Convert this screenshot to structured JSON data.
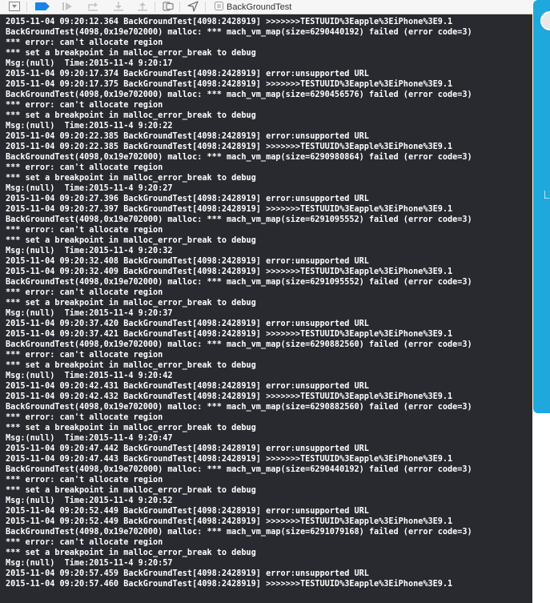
{
  "toolbar": {
    "icons": [
      "hide-console-icon",
      "breakpoint-icon",
      "continue-icon",
      "step-over-icon",
      "step-in-icon",
      "step-out-icon",
      "view-debugger-icon",
      "simulate-location-icon",
      "target-app-icon"
    ],
    "target": "BackGroundTest"
  },
  "colors": {
    "console_bg": "#292a30",
    "console_text": "#ffffff",
    "accent": "#1fa8dc",
    "breakpoint": "#1a83e6"
  },
  "console": {
    "lines": [
      "2015-11-04 09:20:12.364 BackGroundTest[4098:2428919] >>>>>>>TESTUUID%3Eapple%3EiPhone%3E9.1",
      "BackGroundTest(4098,0x19e702000) malloc: *** mach_vm_map(size=6290440192) failed (error code=3)",
      "*** error: can't allocate region",
      "*** set a breakpoint in malloc_error_break to debug",
      "Msg:(null)  Time:2015-11-4 9:20:17",
      "2015-11-04 09:20:17.374 BackGroundTest[4098:2428919] error:unsupported URL",
      "2015-11-04 09:20:17.375 BackGroundTest[4098:2428919] >>>>>>>TESTUUID%3Eapple%3EiPhone%3E9.1",
      "BackGroundTest(4098,0x19e702000) malloc: *** mach_vm_map(size=6290456576) failed (error code=3)",
      "*** error: can't allocate region",
      "*** set a breakpoint in malloc_error_break to debug",
      "Msg:(null)  Time:2015-11-4 9:20:22",
      "2015-11-04 09:20:22.385 BackGroundTest[4098:2428919] error:unsupported URL",
      "2015-11-04 09:20:22.385 BackGroundTest[4098:2428919] >>>>>>>TESTUUID%3Eapple%3EiPhone%3E9.1",
      "BackGroundTest(4098,0x19e702000) malloc: *** mach_vm_map(size=6290980864) failed (error code=3)",
      "*** error: can't allocate region",
      "*** set a breakpoint in malloc_error_break to debug",
      "Msg:(null)  Time:2015-11-4 9:20:27",
      "2015-11-04 09:20:27.396 BackGroundTest[4098:2428919] error:unsupported URL",
      "2015-11-04 09:20:27.397 BackGroundTest[4098:2428919] >>>>>>>TESTUUID%3Eapple%3EiPhone%3E9.1",
      "BackGroundTest(4098,0x19e702000) malloc: *** mach_vm_map(size=6291095552) failed (error code=3)",
      "*** error: can't allocate region",
      "*** set a breakpoint in malloc_error_break to debug",
      "Msg:(null)  Time:2015-11-4 9:20:32",
      "2015-11-04 09:20:32.408 BackGroundTest[4098:2428919] error:unsupported URL",
      "2015-11-04 09:20:32.409 BackGroundTest[4098:2428919] >>>>>>>TESTUUID%3Eapple%3EiPhone%3E9.1",
      "BackGroundTest(4098,0x19e702000) malloc: *** mach_vm_map(size=6291095552) failed (error code=3)",
      "*** error: can't allocate region",
      "*** set a breakpoint in malloc_error_break to debug",
      "Msg:(null)  Time:2015-11-4 9:20:37",
      "2015-11-04 09:20:37.420 BackGroundTest[4098:2428919] error:unsupported URL",
      "2015-11-04 09:20:37.421 BackGroundTest[4098:2428919] >>>>>>>TESTUUID%3Eapple%3EiPhone%3E9.1",
      "BackGroundTest(4098,0x19e702000) malloc: *** mach_vm_map(size=6290882560) failed (error code=3)",
      "*** error: can't allocate region",
      "*** set a breakpoint in malloc_error_break to debug",
      "Msg:(null)  Time:2015-11-4 9:20:42",
      "2015-11-04 09:20:42.431 BackGroundTest[4098:2428919] error:unsupported URL",
      "2015-11-04 09:20:42.432 BackGroundTest[4098:2428919] >>>>>>>TESTUUID%3Eapple%3EiPhone%3E9.1",
      "BackGroundTest(4098,0x19e702000) malloc: *** mach_vm_map(size=6290882560) failed (error code=3)",
      "*** error: can't allocate region",
      "*** set a breakpoint in malloc_error_break to debug",
      "Msg:(null)  Time:2015-11-4 9:20:47",
      "2015-11-04 09:20:47.442 BackGroundTest[4098:2428919] error:unsupported URL",
      "2015-11-04 09:20:47.443 BackGroundTest[4098:2428919] >>>>>>>TESTUUID%3Eapple%3EiPhone%3E9.1",
      "BackGroundTest(4098,0x19e702000) malloc: *** mach_vm_map(size=6290440192) failed (error code=3)",
      "*** error: can't allocate region",
      "*** set a breakpoint in malloc_error_break to debug",
      "Msg:(null)  Time:2015-11-4 9:20:52",
      "2015-11-04 09:20:52.449 BackGroundTest[4098:2428919] error:unsupported URL",
      "2015-11-04 09:20:52.449 BackGroundTest[4098:2428919] >>>>>>>TESTUUID%3Eapple%3EiPhone%3E9.1",
      "BackGroundTest(4098,0x19e702000) malloc: *** mach_vm_map(size=6291079168) failed (error code=3)",
      "*** error: can't allocate region",
      "*** set a breakpoint in malloc_error_break to debug",
      "Msg:(null)  Time:2015-11-4 9:20:57",
      "2015-11-04 09:20:57.459 BackGroundTest[4098:2428919] error:unsupported URL",
      "2015-11-04 09:20:57.460 BackGroundTest[4098:2428919] >>>>>>>TESTUUID%3Eapple%3EiPhone%3E9.1"
    ]
  }
}
